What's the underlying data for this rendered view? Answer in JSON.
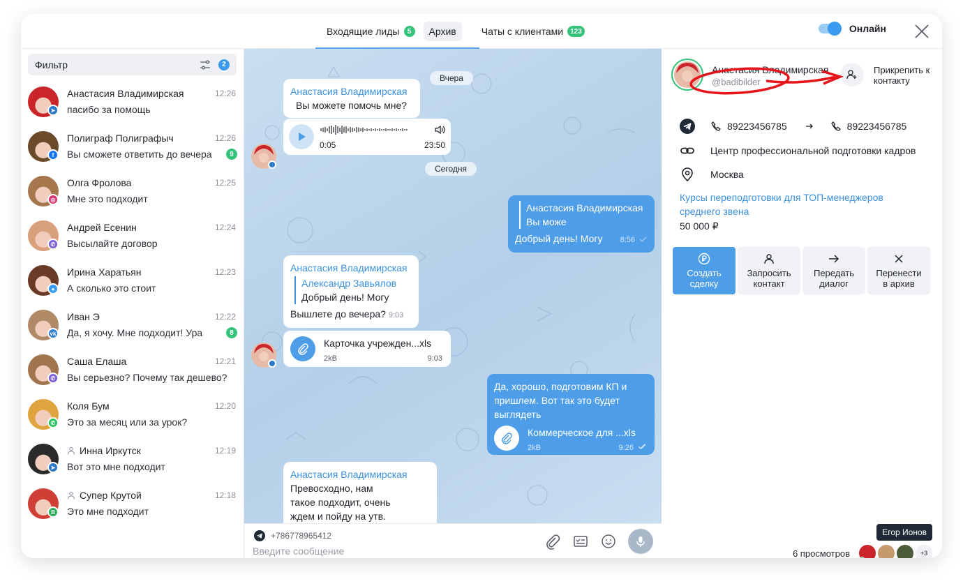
{
  "header": {
    "tabs": [
      {
        "label": "Входящие лиды",
        "badge": "5"
      },
      {
        "label": "Архив"
      },
      {
        "label": "Чаты с клиентами",
        "badge": "123"
      }
    ],
    "online_label": "Онлайн",
    "online_on": true,
    "colors": {
      "accent": "#3a9af0",
      "badge": "#34c37a"
    }
  },
  "sidebar": {
    "filter_label": "Фильтр",
    "filter_count": "2",
    "chats": [
      {
        "name": "Анастасия Владимирская",
        "time": "12:26",
        "message": "пасибо за помощь",
        "network": "telegram"
      },
      {
        "name": "Полиграф Полиграфыч",
        "time": "12:26",
        "message": "Вы сможете ответить до вечера",
        "network": "facebook",
        "unread": "9"
      },
      {
        "name": "Олга Фролова",
        "time": "12:25",
        "message": "Мне это подходит",
        "network": "instagram"
      },
      {
        "name": "Андрей Есенин",
        "time": "12:24",
        "message": "Высылайте договор",
        "network": "viber"
      },
      {
        "name": "Ирина Харатьян",
        "time": "12:23",
        "message": "А сколько это стоит",
        "network": "messenger"
      },
      {
        "name": "Иван Э",
        "time": "12:22",
        "message": "Да, я хочу. Мне подходит! Ура",
        "network": "vk",
        "unread": "8"
      },
      {
        "name": "Саша Елаша",
        "time": "12:21",
        "message": "Вы серьезно? Почему так дешево?",
        "network": "viber"
      },
      {
        "name": "Коля Бум",
        "time": "12:20",
        "message": "Это за месяц или за урок?",
        "network": "whatsapp"
      },
      {
        "name": "Инна Иркутск",
        "time": "12:19",
        "message": "Вот это мне подходит",
        "network": "telegram",
        "contact_icon": true
      },
      {
        "name": "Супер Крутой",
        "time": "12:18",
        "message": "Это мне подходит",
        "network": "green-b",
        "contact_icon": true
      }
    ]
  },
  "chat": {
    "day1": "Вчера",
    "day2": "Сегодня",
    "msg1": {
      "sender": "Анастасия Владимирская",
      "text": "Вы можете помочь мне?"
    },
    "voice": {
      "elapsed": "0:05",
      "time": "23:50"
    },
    "out1": {
      "quote_sender": "Анастасия Владимирская",
      "quote_text": "Вы може",
      "text": "Добрый день! Могу",
      "time": "8:56"
    },
    "msg2": {
      "sender": "Анастасия Владимирская",
      "quote_sender": "Александр Завьялов",
      "quote_text": "Добрый день! Могу",
      "text": "Вышлете до вечера?",
      "time": "9:03"
    },
    "file1": {
      "name": "Карточка учрежден...xls",
      "size": "2kB",
      "time": "9:03"
    },
    "out2": {
      "text": "Да, хорошо, подготовим КП и пришлем. Вот так это будет выглядеть",
      "file_name": "Коммерческое для ...xls",
      "file_size": "2kB",
      "time": "9:26"
    },
    "msg3": {
      "sender": "Анастасия Владимирская",
      "text": "Превосходно, нам такое подходит, очень ждем и пойду на утв."
    },
    "composer": {
      "phone": "+786778965412",
      "placeholder": "Введите сообщение"
    }
  },
  "panel": {
    "name": "Анастасия Владимирская",
    "handle": "@badibilder",
    "attach_label": "Прикрепить к контакту",
    "phone_from": "89223456785",
    "phone_to": "89223456785",
    "org": "Центр профессиональной подготовки кадров",
    "city": "Москва",
    "course": "Курсы переподготовки для ТОП-менеджеров среднего звена",
    "price": "50 000 ₽",
    "actions": [
      {
        "label1": "Создать",
        "label2": "сделку",
        "icon": "ruble-icon"
      },
      {
        "label1": "Запросить",
        "label2": "контакт",
        "icon": "person-icon"
      },
      {
        "label1": "Передать",
        "label2": "диалог",
        "icon": "arrow-right-icon"
      },
      {
        "label1": "Перенести",
        "label2": "в архив",
        "icon": "close-icon"
      }
    ],
    "views": "6 просмотров",
    "viewers_more": "+3",
    "tooltip": "Егор Ионов",
    "annotation_color": "#e8141b"
  }
}
